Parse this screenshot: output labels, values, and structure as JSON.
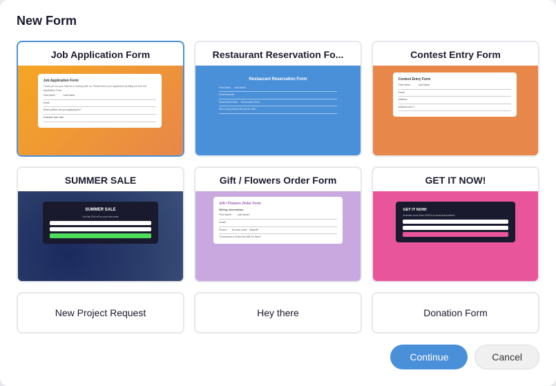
{
  "dialog": {
    "title": "New Form"
  },
  "cards": [
    {
      "id": "job-application",
      "title": "Job Application Form",
      "preview_type": "job",
      "selected": true
    },
    {
      "id": "restaurant-reservation",
      "title": "Restaurant Reservation Fo...",
      "preview_type": "restaurant",
      "selected": false
    },
    {
      "id": "contest-entry",
      "title": "Contest Entry Form",
      "preview_type": "contest",
      "selected": false
    },
    {
      "id": "summer-sale",
      "title": "SUMMER SALE",
      "preview_type": "summer",
      "selected": false
    },
    {
      "id": "gift-flowers",
      "title": "Gift / Flowers Order Form",
      "preview_type": "flowers",
      "selected": false
    },
    {
      "id": "get-it-now",
      "title": "GET IT NOW!",
      "preview_type": "getit",
      "selected": false
    }
  ],
  "bottom_cards": [
    {
      "id": "new-project",
      "title": "New Project Request"
    },
    {
      "id": "hey-there",
      "title": "Hey there"
    },
    {
      "id": "donation",
      "title": "Donation Form"
    }
  ],
  "buttons": {
    "continue": "Continue",
    "cancel": "Cancel"
  }
}
